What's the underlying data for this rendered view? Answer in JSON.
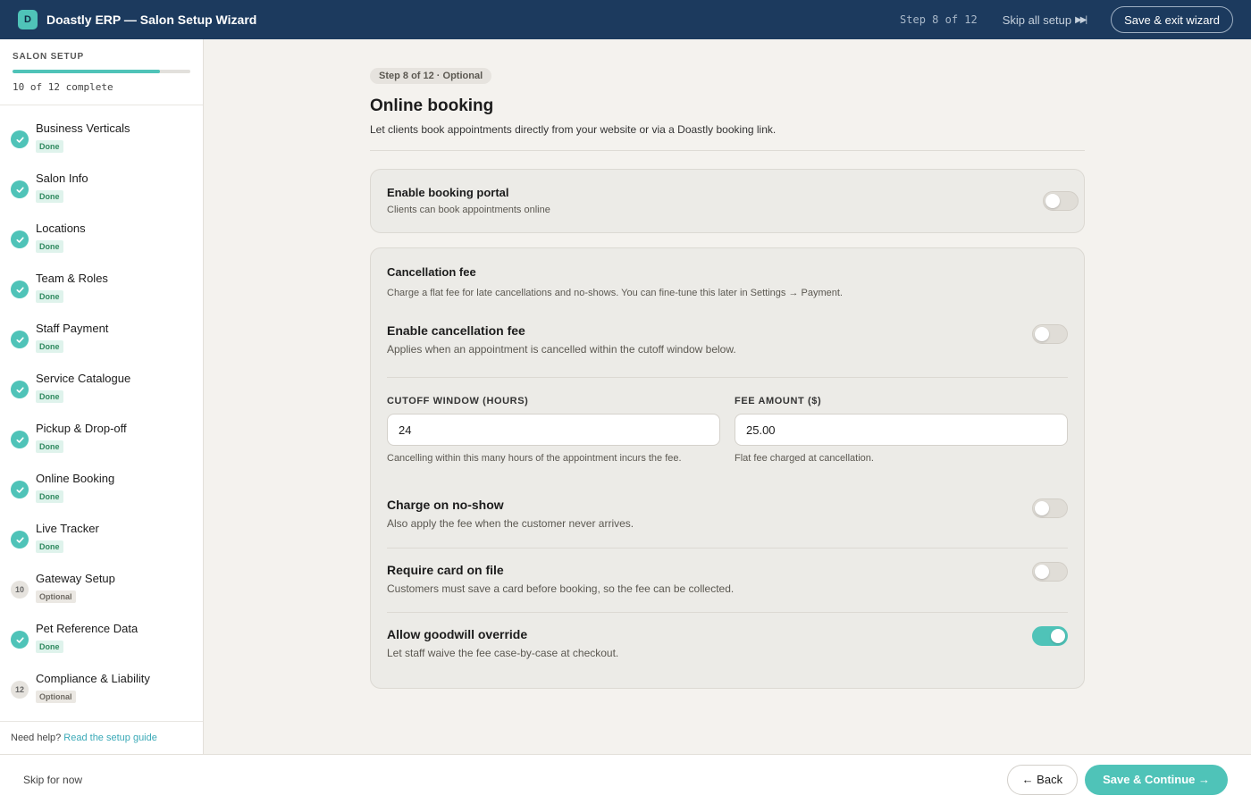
{
  "header": {
    "logo_letter": "D",
    "title": "Doastly ERP — Salon Setup Wizard",
    "step_counter": "Step 8 of 12",
    "skip_all_label": "Skip all setup",
    "save_exit_label": "Save & exit wizard"
  },
  "sidebar": {
    "section_label": "SALON SETUP",
    "progress_fraction": 0.83,
    "progress_text": "10 of 12 complete",
    "steps": [
      {
        "label": "Business Verticals",
        "status": "Done",
        "state": "done",
        "number": ""
      },
      {
        "label": "Salon Info",
        "status": "Done",
        "state": "done",
        "number": ""
      },
      {
        "label": "Locations",
        "status": "Done",
        "state": "done",
        "number": ""
      },
      {
        "label": "Team & Roles",
        "status": "Done",
        "state": "done",
        "number": ""
      },
      {
        "label": "Staff Payment",
        "status": "Done",
        "state": "done",
        "number": ""
      },
      {
        "label": "Service Catalogue",
        "status": "Done",
        "state": "done",
        "number": ""
      },
      {
        "label": "Pickup & Drop-off",
        "status": "Done",
        "state": "done",
        "number": ""
      },
      {
        "label": "Online Booking",
        "status": "Done",
        "state": "done",
        "number": ""
      },
      {
        "label": "Live Tracker",
        "status": "Done",
        "state": "done",
        "number": ""
      },
      {
        "label": "Gateway Setup",
        "status": "Optional",
        "state": "optional",
        "number": "10"
      },
      {
        "label": "Pet Reference Data",
        "status": "Done",
        "state": "done",
        "number": ""
      },
      {
        "label": "Compliance & Liability",
        "status": "Optional",
        "state": "optional",
        "number": "12"
      }
    ],
    "help_text": "Need help?",
    "help_link": "Read the setup guide"
  },
  "main": {
    "step_pill": "Step 8 of 12 · Optional",
    "title": "Online booking",
    "subtitle": "Let clients book appointments directly from your website or via a Doastly booking link.",
    "portal": {
      "title": "Enable booking portal",
      "subtitle": "Clients can book appointments online",
      "enabled": false
    },
    "cancellation": {
      "title": "Cancellation fee",
      "subtitle": "Charge a flat fee for late cancellations and no-shows. You can fine-tune this later in Settings → Payment.",
      "enable_title": "Enable cancellation fee",
      "enable_sub": "Applies when an appointment is cancelled within the cutoff window below.",
      "enable_on": false,
      "cutoff_label": "CUTOFF WINDOW (HOURS)",
      "cutoff_value": "24",
      "cutoff_help": "Cancelling within this many hours of the appointment incurs the fee.",
      "fee_label": "FEE AMOUNT ($)",
      "fee_value": "25.00",
      "fee_help": "Flat fee charged at cancellation.",
      "noshow_title": "Charge on no-show",
      "noshow_sub": "Also apply the fee when the customer never arrives.",
      "noshow_on": false,
      "card_title": "Require card on file",
      "card_sub": "Customers must save a card before booking, so the fee can be collected.",
      "card_on": false,
      "goodwill_title": "Allow goodwill override",
      "goodwill_sub": "Let staff waive the fee case-by-case at checkout.",
      "goodwill_on": true
    }
  },
  "footer": {
    "skip_label": "Skip for now",
    "back_label": "← Back",
    "continue_label": "Save & Continue →"
  },
  "colors": {
    "header_bg": "#1c3a5e",
    "accent": "#4fc3b8"
  }
}
